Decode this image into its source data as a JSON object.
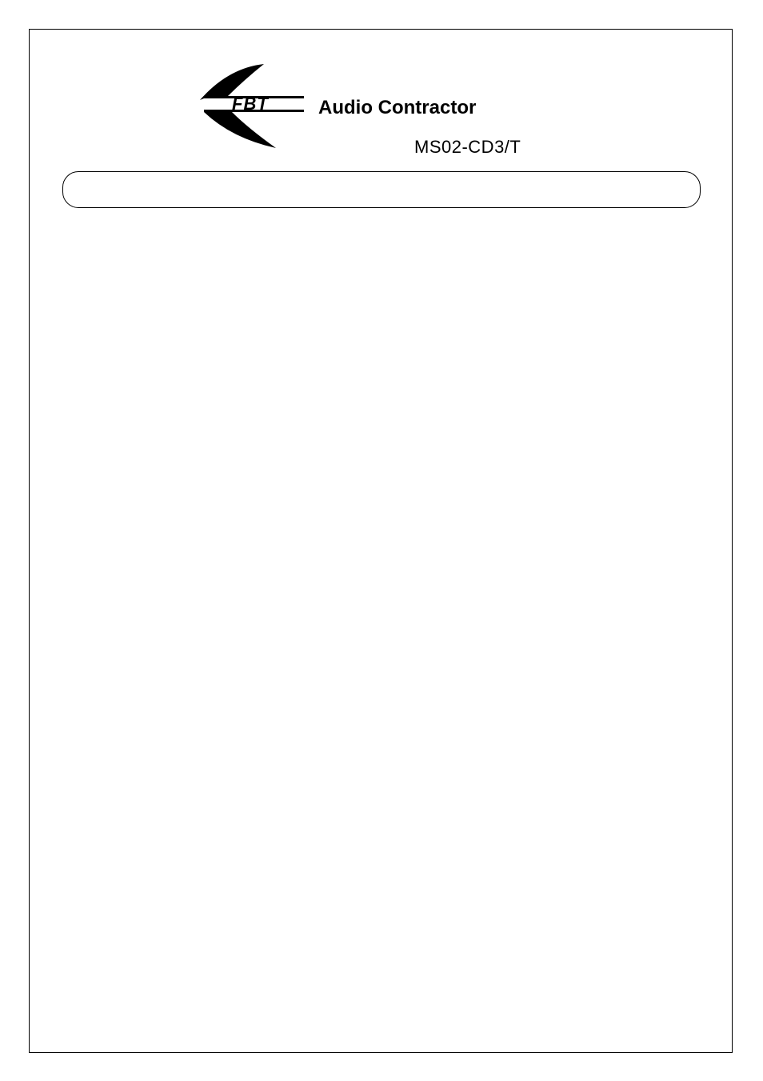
{
  "logo": {
    "wordmark": "FBT",
    "brand": "Audio Contractor"
  },
  "model": "MS02-CD3/T"
}
